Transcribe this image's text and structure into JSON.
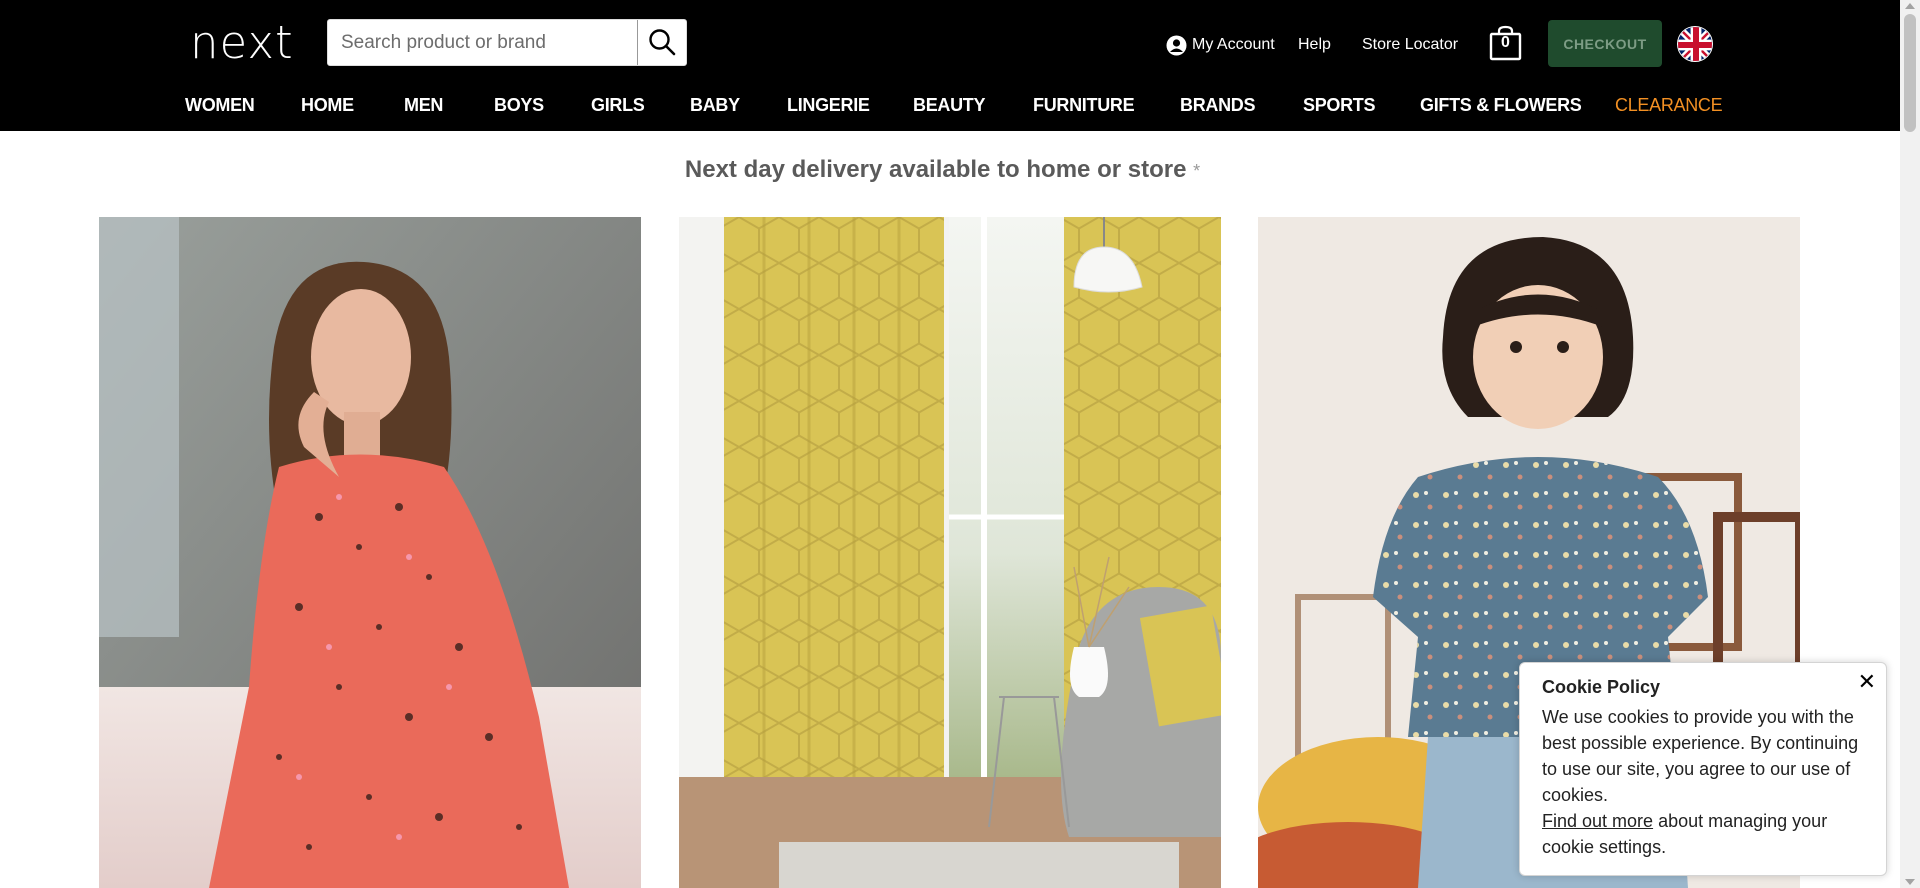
{
  "header": {
    "logo": "next",
    "search_placeholder": "Search product or brand",
    "account_label": "My Account",
    "help_label": "Help",
    "store_locator_label": "Store Locator",
    "bag_count": "0",
    "checkout_label": "CHECKOUT",
    "country_flag": "uk-flag-icon"
  },
  "nav": {
    "items": [
      {
        "label": "WOMEN"
      },
      {
        "label": "HOME"
      },
      {
        "label": "MEN"
      },
      {
        "label": "BOYS"
      },
      {
        "label": "GIRLS"
      },
      {
        "label": "BABY"
      },
      {
        "label": "LINGERIE"
      },
      {
        "label": "BEAUTY"
      },
      {
        "label": "FURNITURE"
      },
      {
        "label": "BRANDS"
      },
      {
        "label": "SPORTS"
      },
      {
        "label": "GIFTS & FLOWERS"
      },
      {
        "label": "CLEARANCE"
      }
    ],
    "clearance_color": "#f39023"
  },
  "main": {
    "delivery_text": "Next day delivery available to home or store",
    "delivery_asterisk": "*"
  },
  "cookie": {
    "title": "Cookie Policy",
    "body": "We use cookies to provide you with the best possible experience. By continuing to use our site, you agree to our use of cookies.",
    "link_text": "Find out more",
    "link_suffix": " about managing your cookie settings.",
    "close_label": "✕"
  },
  "colors": {
    "header_bg": "#000000",
    "checkout_bg": "#1f4b2d",
    "checkout_text": "#7d9c85"
  }
}
